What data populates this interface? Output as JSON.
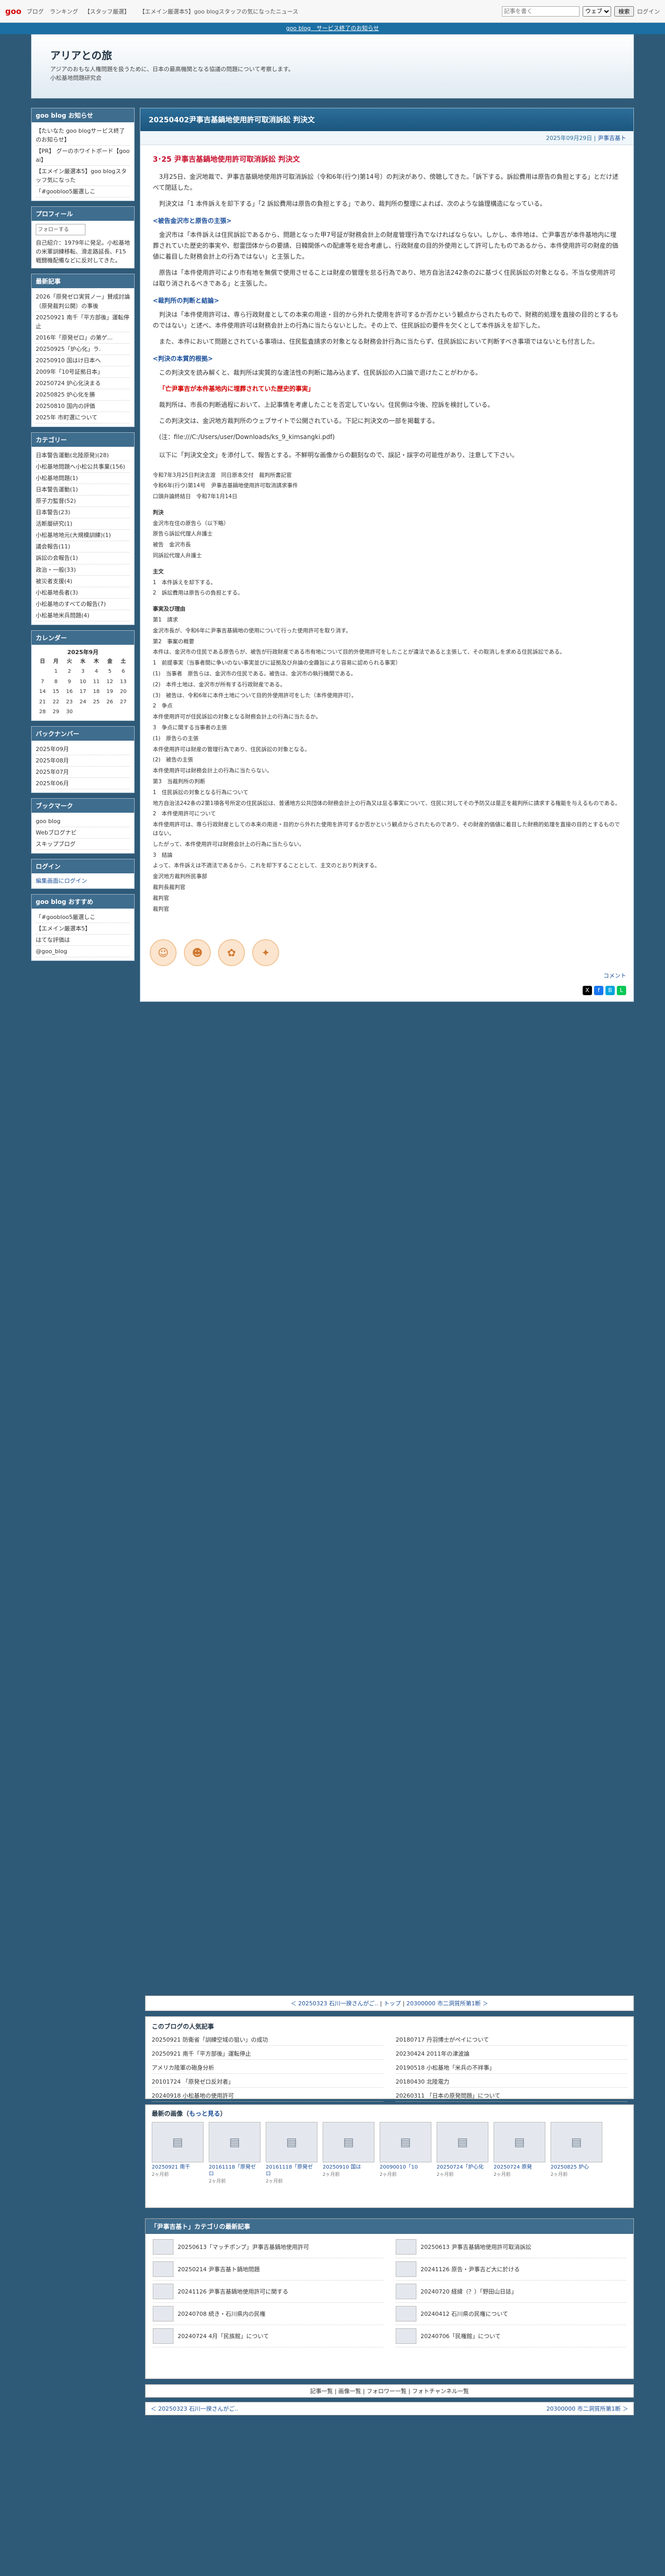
{
  "topbar": {
    "logo": "goo",
    "nav": [
      "ブログ",
      "ランキング",
      "【スタッフ厳選】"
    ],
    "news": "【エメイン厳選本5】goo blogスタッフの気になったニュース",
    "search_placeholder": "記事を書く",
    "select_value": "ウェブ",
    "search_button": "検索",
    "login": "ログイン"
  },
  "promo": {
    "text": "goo blog　サービス終了のお知らせ"
  },
  "blog": {
    "title": "アリアとの旅",
    "subtitle": "アジアのおもな人権問題を扱うために、日本の最高機関となる協議の問題について考察します。",
    "author_line": "小松基地問題研究会"
  },
  "sidebar": {
    "news_title": "goo blog お知らせ",
    "news_items": [
      "【たいなた goo blogサービス終了のお知らせ】",
      "【PR】 グーのホワイトボード【goo ai】",
      "【エメイン厳選本5】goo blogスタッフ気になった",
      "「#goobloo5厳選しこ"
    ],
    "profile_title": "プロフィール",
    "profile_button": "フォローする",
    "profile_text": "自己紹介：1979年に発足。小松基地の米軍訓練移転、滑走路延長、F15戦闘機配備などに反対してきた。",
    "recent_title": "最新記事",
    "recent_items": [
      "2026「原発ゼロ実質ノー」賛成討論（原発裁判公開）の事後",
      "20250921 南千「平方部後」運転停止",
      "2016年「原発ゼロ」の第ゲ...",
      "20250925「炉心化」ラ.",
      "20250910 国はけ日本へ",
      "2009年「10号証拠日本」",
      "20250724 炉心化決まる",
      "20250825 炉心化を勝",
      "20250810 国内の評価",
      "2025年 市町選について"
    ],
    "category_title": "カテゴリー",
    "categories": [
      "日本警告運動(北陸原発)(28)",
      "小松基地問題へ小松公共事業(156)",
      "小松基地問題(1)",
      "日本警告運動(1)",
      "原子力監督(52)",
      "日本警告(23)",
      "活断層研究(1)",
      "小松基地地元(大規模訓練)(1)",
      "議会報告(11)",
      "訴訟の会報告(1)",
      "政治・一般(33)",
      "被災者支援(4)",
      "小松基地長者(3)",
      "小松基地のすべての報告(7)",
      "小松基地米兵問題(4)"
    ],
    "calendar_title": "カレンダー",
    "calendar_month": "2025年9月",
    "calendar_head": [
      "日",
      "月",
      "火",
      "水",
      "木",
      "金",
      "土"
    ],
    "calendar_rows": [
      [
        "",
        "1",
        "2",
        "3",
        "4",
        "5",
        "6"
      ],
      [
        "7",
        "8",
        "9",
        "10",
        "11",
        "12",
        "13"
      ],
      [
        "14",
        "15",
        "16",
        "17",
        "18",
        "19",
        "20"
      ],
      [
        "21",
        "22",
        "23",
        "24",
        "25",
        "26",
        "27"
      ],
      [
        "28",
        "29",
        "30",
        "",
        "",
        "",
        ""
      ]
    ],
    "archive_title": "バックナンバー",
    "archives": [
      "2025年09月",
      "2025年08月",
      "2025年07月",
      "2025年06月"
    ],
    "bookmark_title": "ブックマーク",
    "bookmarks": [
      "goo blog",
      "Webブログナビ",
      "スキップブログ"
    ],
    "login_title": "ログイン",
    "login_link": "編集画面にログイン",
    "footer_title": "goo blog おすすめ",
    "footer_items": [
      "「#goobloo5厳選しこ",
      "【エメイン厳選本5】",
      "はてな評価は",
      "@goo_blog"
    ]
  },
  "article": {
    "title": "20250402尹事吉基鍋地使用許可取消訴訟 判決文",
    "date": "2025年09月29日",
    "category": "尹事吉基ト",
    "heading": "3･25 尹事吉基鍋地使用許可取消訴訟 判決文",
    "intro": "3月25日、金沢地裁で、尹事吉基鍋地使用許可取消訴訟（令和6年(行ウ)第14号）の判決があり、傍聴してきた。「訴下する。訴訟費用は原告の負担とする」とだけ述べて閉廷した。",
    "intro2": "判決文は「1 本件訴えを却下する」「2 訴訟費用は原告の負担とする」であり、裁判所の整理によれば、次のような論理構造になっている。",
    "sec1": "<被告金沢市と原告の主張>",
    "para1": "金沢市は「本件訴えは住民訴訟であるから、問題となった甲7号証が財務会計上の財産管理行為でなければならない。しかし、本件地は、亡尹事吉が本件基地内に埋葬されていた歴史的事実や、慰霊団体からの要請、日韓関係への配慮等を総合考慮し、行政財産の目的外使用として許可したものであるから、本件使用許可の財産的価値に着目した財務会計上の行為ではない」と主張した。",
    "para2": "原告は「本件使用許可により市有地を無償で使用させることは財産の管理を怠る行為であり、地方自治法242条の2に基づく住民訴訟の対象となる。不当な使用許可は取り消されるべきである」と主張した。",
    "sec2": "<裁判所の判断と結論>",
    "para3": "判決は「本件使用許可は、専ら行政財産としての本来の用途・目的から外れた使用を許可するか否かという観点からされたもので、財務的処理を直接の目的とするものではない」と述べ、本件使用許可は財務会計上の行為に当たらないとした。その上で、住民訴訟の要件を欠くとして本件訴えを却下した。",
    "para4": "また、本件において問題とされている事項は、住民監査請求の対象となる財務会計行為に当たらず、住民訴訟において判断すべき事項ではないとも付言した。",
    "sec3": "<判決の本質的根拠>",
    "para5": "この判決文を読み解くと、裁判所は実質的な違法性の判断に踏み込まず、住民訴訟の入口論で退けたことがわかる。",
    "red": "「亡尹事吉が本件基地内に埋葬されていた歴史的事実」",
    "para6": "裁判所は、市長の判断過程において、上記事情を考慮したことを否定していない。住民側は今後、控訴を検討している。",
    "para7": "この判決文は、金沢地方裁判所のウェブサイトで公開されている。下記に判決文の一部を掲載する。",
    "file_path": "(注：file:///C:/Users/user/Downloads/ks_9_kimsangki.pdf)",
    "quote": "以下に「判決文全文」を添付して、報告とする。不鮮明な画像からの翻刻なので、誤記・誤字の可能性があり、注意して下さい。",
    "case_lines": [
      "令和7年3月25日判決言渡　同日原本交付　裁判所書記官",
      "令和6年(行ウ)第14号　尹事吉基鍋地使用許可取消請求事件",
      "口頭弁論終結日　令和7年1月14日"
    ],
    "judgment_title": "判決",
    "parties": [
      "金沢市在住の原告ら（以下略）",
      "原告ら訴訟代理人弁護士",
      "被告　金沢市長",
      "同訴訟代理人弁護士"
    ],
    "main_title": "主文",
    "main_items": [
      "1　本件訴えを却下する。",
      "2　訴訟費用は原告らの負担とする。"
    ],
    "facts_title": "事実及び理由",
    "facts": [
      "第1　請求",
      "金沢市長が、令和6年に尹事吉基鍋地の使用について行った使用許可を取り消す。",
      "第2　事案の概要",
      "本件は、金沢市の住民である原告らが、被告が行政財産である市有地について目的外使用許可をしたことが違法であると主張して、その取消しを求める住民訴訟である。",
      "1　前提事実（当事者間に争いのない事実並びに証拠及び弁論の全趣旨により容易に認められる事実）",
      "(1)　当事者　原告らは、金沢市の住民である。被告は、金沢市の執行機関である。",
      "(2)　本件土地は、金沢市が所有する行政財産である。",
      "(3)　被告は、令和6年に本件土地について目的外使用許可をした（本件使用許可）。",
      "2　争点",
      "本件使用許可が住民訴訟の対象となる財務会計上の行為に当たるか。",
      "3　争点に関する当事者の主張",
      "(1)　原告らの主張",
      "本件使用許可は財産の管理行為であり、住民訴訟の対象となる。",
      "(2)　被告の主張",
      "本件使用許可は財務会計上の行為に当たらない。",
      "第3　当裁判所の判断",
      "1　住民訴訟の対象となる行為について",
      "地方自治法242条の2第1項各号所定の住民訴訟は、普通地方公共団体の財務会計上の行為又は怠る事実について、住民に対してその予防又は是正を裁判所に請求する権能を与えるものである。",
      "2　本件使用許可について",
      "本件使用許可は、専ら行政財産としての本来の用途・目的から外れた使用を許可するか否かという観点からされたものであり、その財産的価値に着目した財務的処理を直接の目的とするものではない。",
      "したがって、本件使用許可は財務会計上の行為に当たらない。",
      "3　結論",
      "よって、本件訴えは不適法であるから、これを却下することとして、主文のとおり判決する。",
      "金沢地方裁判所民事部",
      "裁判長裁判官",
      "裁判官",
      "裁判官"
    ],
    "comment_label": "コメント",
    "stickers": [
      "☺",
      "☻",
      "✿",
      "✦"
    ]
  },
  "pager": {
    "prev": "＜ 20250323 石川一揆さんがご..",
    "top": "トップ",
    "next": "20300000 市二洞質所第1断 ＞"
  },
  "other_blogs": {
    "title": "このブログの人気記事",
    "items": [
      "20250921 防衛省「訓練空域の狙い」の成功",
      "20180717 丹羽博士がペイについて",
      "20250921 南千「平方部後」運転停止",
      "20230424 2011年の津波論",
      "アメリカ陸軍の砲身分析",
      "20190518 小松基地「米兵の不祥事」",
      "20101724 「原発ゼロ反対者」",
      "20180430 北陸電力",
      "20240918 小松基地の使用許可",
      "20260311 「日本の原発問題」について"
    ]
  },
  "recent_images": {
    "title": "最新の画像",
    "more": "もっと見る",
    "items": [
      {
        "t": "20250921 南千",
        "d": "2ヶ月前"
      },
      {
        "t": "20161118「原発ゼロ",
        "d": "2ヶ月前"
      },
      {
        "t": "20161118「原発ゼロ",
        "d": "2ヶ月前"
      },
      {
        "t": "20250910 国は",
        "d": "2ヶ月前"
      },
      {
        "t": "20090010「10",
        "d": "2ヶ月前"
      },
      {
        "t": "20250724「炉心化",
        "d": "2ヶ月前"
      },
      {
        "t": "20250724 原発",
        "d": "2ヶ月前"
      },
      {
        "t": "20250825 炉心",
        "d": "2ヶ月前"
      }
    ]
  },
  "category_list": {
    "title": "「尹事吉基ト」カテゴリの最新記事",
    "items": [
      "20250613「マッチポンプ」尹事吉基鍋地使用許可",
      "20250613 尹事吉基鍋地使用許可取消訴訟",
      "20250214 尹事吉基ト鍋地問題",
      "20241126 原告・尹事吉ど大に於ける",
      "20241126 尹事吉基鍋地使用許可に関する",
      "20240720 経緯（？）「野田山日誌」",
      "20240708 続き・石川県内の民権",
      "20240412 石川県の民権について",
      "20240724 4月「民族館」について",
      "20240706「民権館」について"
    ]
  },
  "bottomnav": {
    "text": "記事一覧 | 画像一覧 | フォロワー一覧 | フォトチャンネル一覧"
  },
  "bottombar": {
    "left": "＜ 20250323 石川一揆さんがご..",
    "right": "20300000 市二洞質所第1断 ＞"
  }
}
